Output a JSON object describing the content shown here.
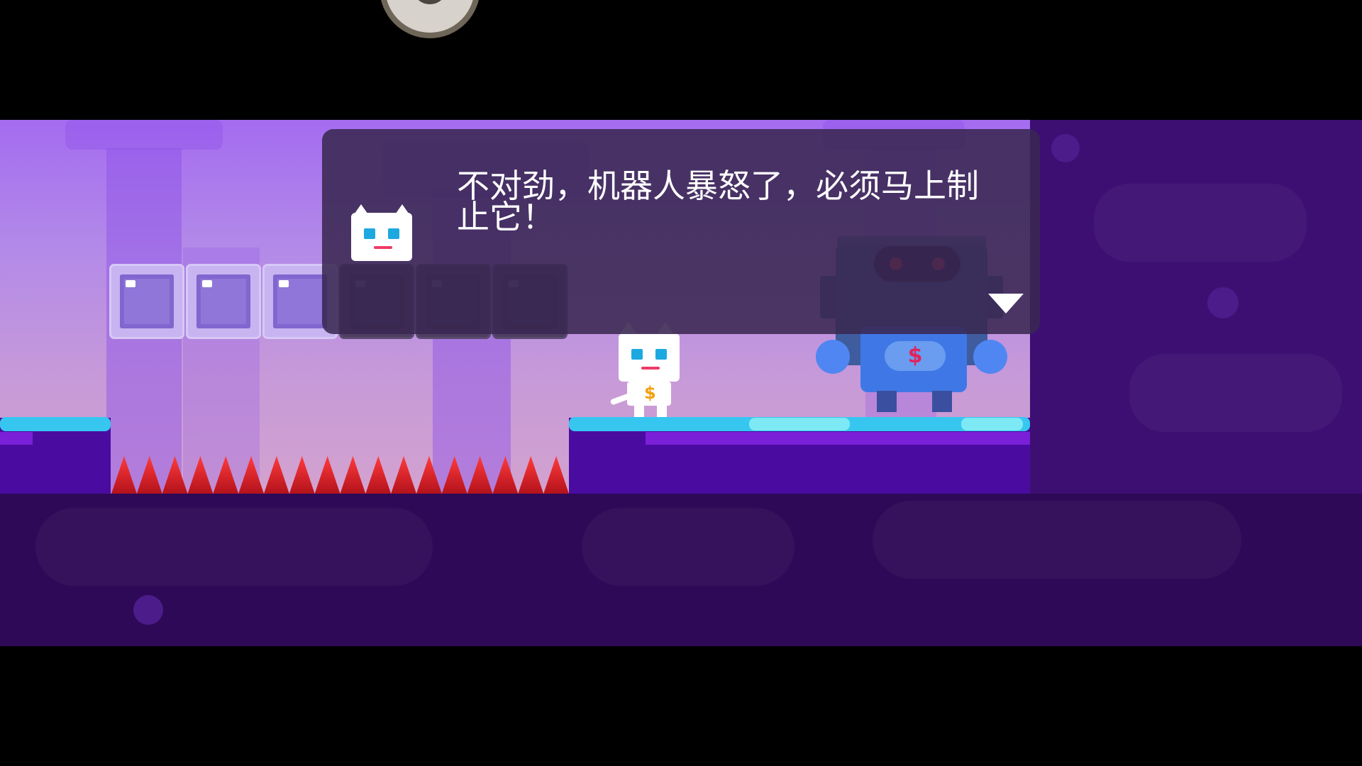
{
  "dialog": {
    "text": "不对劲，机器人暴怒了，必须马上制止它！",
    "speaker_icon": "cat-face-icon",
    "continue_icon": "triangle-down-icon"
  },
  "avatar": {
    "icon": "raccoon-avatar-icon"
  },
  "colors": {
    "sky_top": "#a46cf0",
    "ground_top": "#36c6f0",
    "ground": "#4a0ca0",
    "spikes": "#e01a24",
    "dialog_bg": "#3a2852"
  }
}
